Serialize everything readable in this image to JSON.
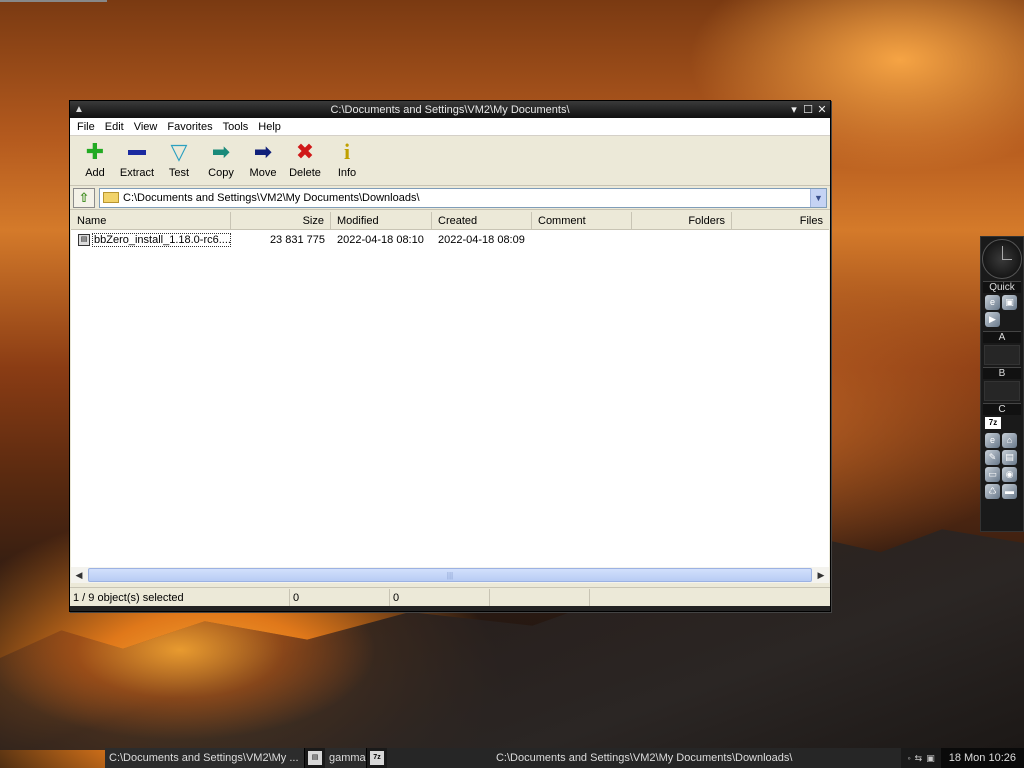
{
  "window": {
    "title": "C:\\Documents and Settings\\VM2\\My Documents\\",
    "system_menu_icon": "caret-up",
    "controls": [
      "minimize",
      "maximize",
      "close"
    ]
  },
  "menu": [
    "File",
    "Edit",
    "View",
    "Favorites",
    "Tools",
    "Help"
  ],
  "toolbar": [
    {
      "label": "Add",
      "icon": "plus-icon",
      "color": "#22aa22"
    },
    {
      "label": "Extract",
      "icon": "minus-icon",
      "color": "#1a2aa0"
    },
    {
      "label": "Test",
      "icon": "check-icon",
      "color": "#2aa0c0"
    },
    {
      "label": "Copy",
      "icon": "copy-arrow-icon",
      "color": "#1a8a7a"
    },
    {
      "label": "Move",
      "icon": "move-arrow-icon",
      "color": "#10207a"
    },
    {
      "label": "Delete",
      "icon": "x-icon",
      "color": "#d01818"
    },
    {
      "label": "Info",
      "icon": "info-icon",
      "color": "#c0a000"
    }
  ],
  "address": {
    "path": "C:\\Documents and Settings\\VM2\\My Documents\\Downloads\\"
  },
  "columns": [
    "Name",
    "Size",
    "Modified",
    "Created",
    "Comment",
    "Folders",
    "Files"
  ],
  "files": [
    {
      "name": "bbZero_install_1.18.0-rc6....",
      "size": "23 831 775",
      "modified": "2022-04-18 08:10",
      "created": "2022-04-18 08:09",
      "comment": "",
      "folders": "",
      "files": ""
    }
  ],
  "status": {
    "selection": "1 / 9 object(s) selected",
    "size1": "0",
    "size2": "0",
    "extra": ""
  },
  "slit": {
    "quick_label": "Quick",
    "sections": [
      "A",
      "B",
      "C"
    ],
    "z_badge": "7z"
  },
  "taskbar": {
    "task1": "C:\\Documents and Settings\\VM2\\My ...",
    "workspace": "gamma",
    "z_badge": "7z",
    "active_window": "C:\\Documents and Settings\\VM2\\My Documents\\Downloads\\",
    "clock": "18 Mon 10:26"
  }
}
